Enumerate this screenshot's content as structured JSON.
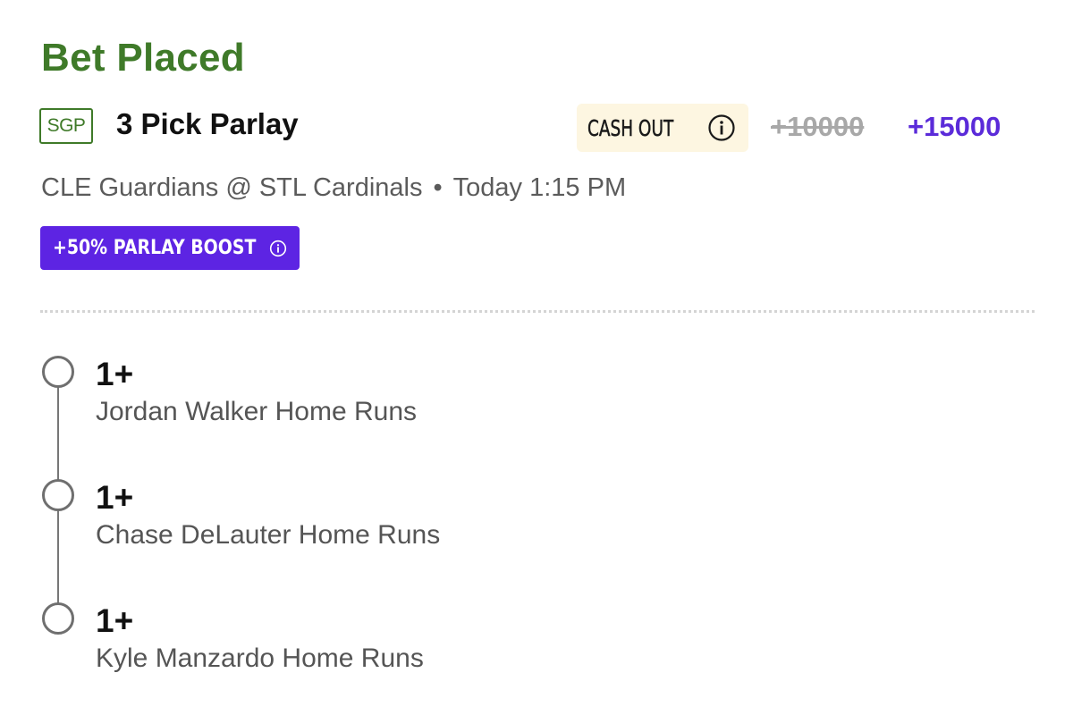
{
  "status": "Bet Placed",
  "header": {
    "badge": "SGP",
    "title": "3 Pick Parlay",
    "cashout_label": "CASH OUT",
    "odds_original": "+10000",
    "odds_boosted": "+15000"
  },
  "game": {
    "matchup": "CLE Guardians @ STL Cardinals",
    "separator": "•",
    "time": "Today 1:15 PM"
  },
  "boost": {
    "label": "+50% PARLAY BOOST"
  },
  "legs": [
    {
      "value": "1+",
      "market": "Jordan Walker Home Runs"
    },
    {
      "value": "1+",
      "market": "Chase DeLauter Home Runs"
    },
    {
      "value": "1+",
      "market": "Kyle Manzardo Home Runs"
    }
  ],
  "colors": {
    "status": "#3f7a29",
    "accent": "#5b2bd9",
    "boost_bg": "#5d24e3",
    "cashout_bg": "#fdf6e1"
  }
}
